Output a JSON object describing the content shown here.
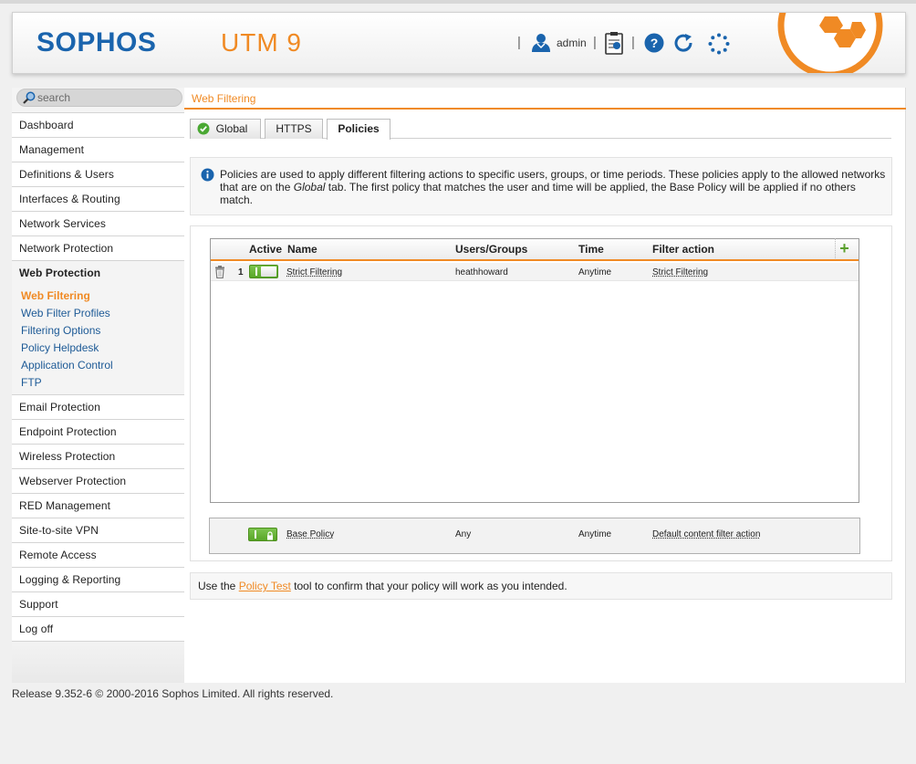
{
  "header": {
    "logo": "SOPHOS",
    "product": "UTM 9",
    "username": "admin",
    "icons": [
      "user-icon",
      "clipboard-icon",
      "help-icon",
      "refresh-icon",
      "spinner-icon"
    ],
    "separator": "|"
  },
  "colors": {
    "brand_blue": "#1a64ad",
    "accent_orange": "#f08a24",
    "link_blue": "#1d5a96",
    "toggle_green": "#58a628"
  },
  "search": {
    "placeholder": "search"
  },
  "sidebar": {
    "items": [
      {
        "label": "Dashboard"
      },
      {
        "label": "Management"
      },
      {
        "label": "Definitions & Users"
      },
      {
        "label": "Interfaces & Routing"
      },
      {
        "label": "Network Services"
      },
      {
        "label": "Network Protection"
      },
      {
        "label": "Web Protection"
      },
      {
        "label": "Email Protection"
      },
      {
        "label": "Endpoint Protection"
      },
      {
        "label": "Wireless Protection"
      },
      {
        "label": "Webserver Protection"
      },
      {
        "label": "RED Management"
      },
      {
        "label": "Site-to-site VPN"
      },
      {
        "label": "Remote Access"
      },
      {
        "label": "Logging & Reporting"
      },
      {
        "label": "Support"
      },
      {
        "label": "Log off"
      }
    ],
    "web_protection_sub": [
      {
        "label": "Web Filtering"
      },
      {
        "label": "Web Filter Profiles"
      },
      {
        "label": "Filtering Options"
      },
      {
        "label": "Policy Helpdesk"
      },
      {
        "label": "Application Control"
      },
      {
        "label": "FTP"
      }
    ]
  },
  "main": {
    "breadcrumb": "Web Filtering",
    "tabs": [
      {
        "label": "Global"
      },
      {
        "label": "HTTPS"
      },
      {
        "label": "Policies"
      }
    ],
    "info": {
      "part1": "Policies are used to apply different filtering actions to specific users, groups, or time periods. These policies apply to the allowed networks that are on the ",
      "global": "Global",
      "part2": " tab. The first policy that matches the user and time will be applied, the Base Policy will be applied if no others match."
    },
    "table": {
      "columns": [
        "Active",
        "Name",
        "Users/Groups",
        "Time",
        "Filter action"
      ],
      "add_label": "+",
      "rows": [
        {
          "position": "1",
          "name": "Strict Filtering",
          "users": "heathhoward",
          "time": "Anytime",
          "filter_action": "Strict Filtering"
        }
      ]
    },
    "base_policy": {
      "name": "Base Policy",
      "users": "Any",
      "time": "Anytime",
      "filter_action": "Default content filter action"
    },
    "policy_test": {
      "before": "Use the ",
      "link": "Policy Test",
      "after": " tool to confirm that your policy will work as you intended."
    }
  },
  "footer": "Release 9.352-6  © 2000-2016 Sophos Limited. All rights reserved."
}
